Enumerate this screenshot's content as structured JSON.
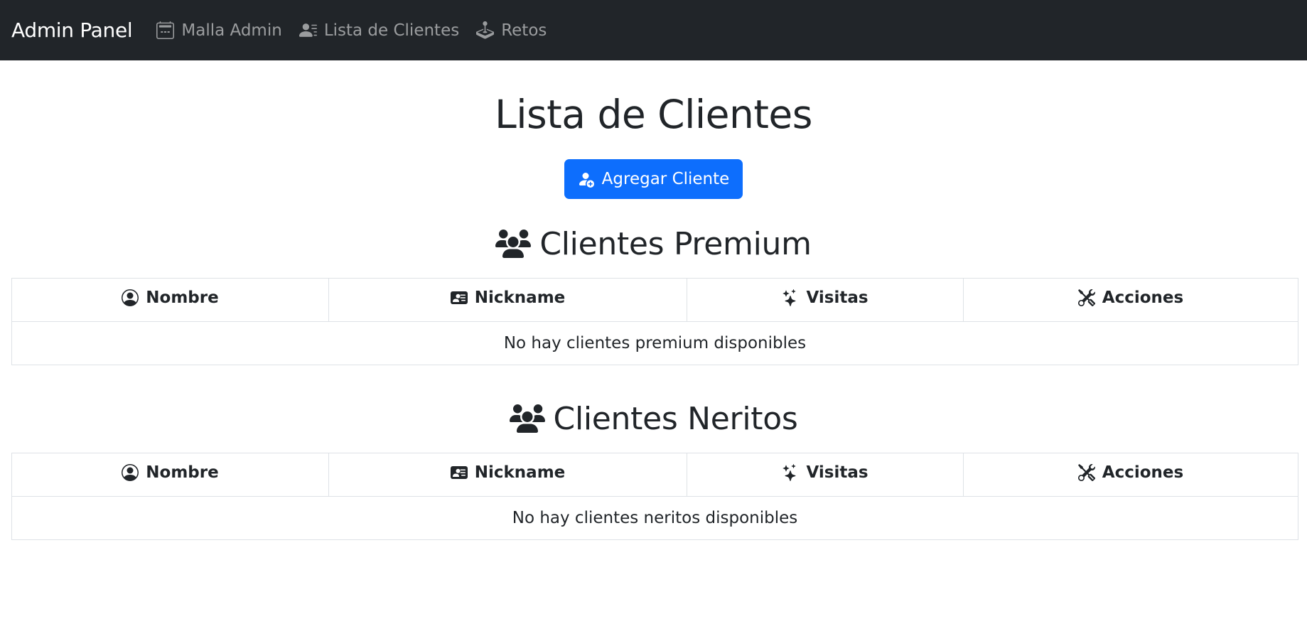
{
  "navbar": {
    "brand": "Admin Panel",
    "items": [
      {
        "label": "Malla Admin",
        "icon": "calendar-icon"
      },
      {
        "label": "Lista de Clientes",
        "icon": "person-lines-icon"
      },
      {
        "label": "Retos",
        "icon": "joystick-icon"
      }
    ]
  },
  "main": {
    "title": "Lista de Clientes",
    "add_button": "Agregar Cliente",
    "premium": {
      "title": "Clientes Premium",
      "columns": [
        "Nombre",
        "Nickname",
        "Visitas",
        "Acciones"
      ],
      "empty_message": "No hay clientes premium disponibles"
    },
    "neritos": {
      "title": "Clientes Neritos",
      "columns": [
        "Nombre",
        "Nickname",
        "Visitas",
        "Acciones"
      ],
      "empty_message": "No hay clientes neritos disponibles"
    }
  },
  "colors": {
    "navbar_bg": "#212529",
    "primary": "#0d6efd",
    "text": "#212529",
    "border": "#dee2e6"
  }
}
